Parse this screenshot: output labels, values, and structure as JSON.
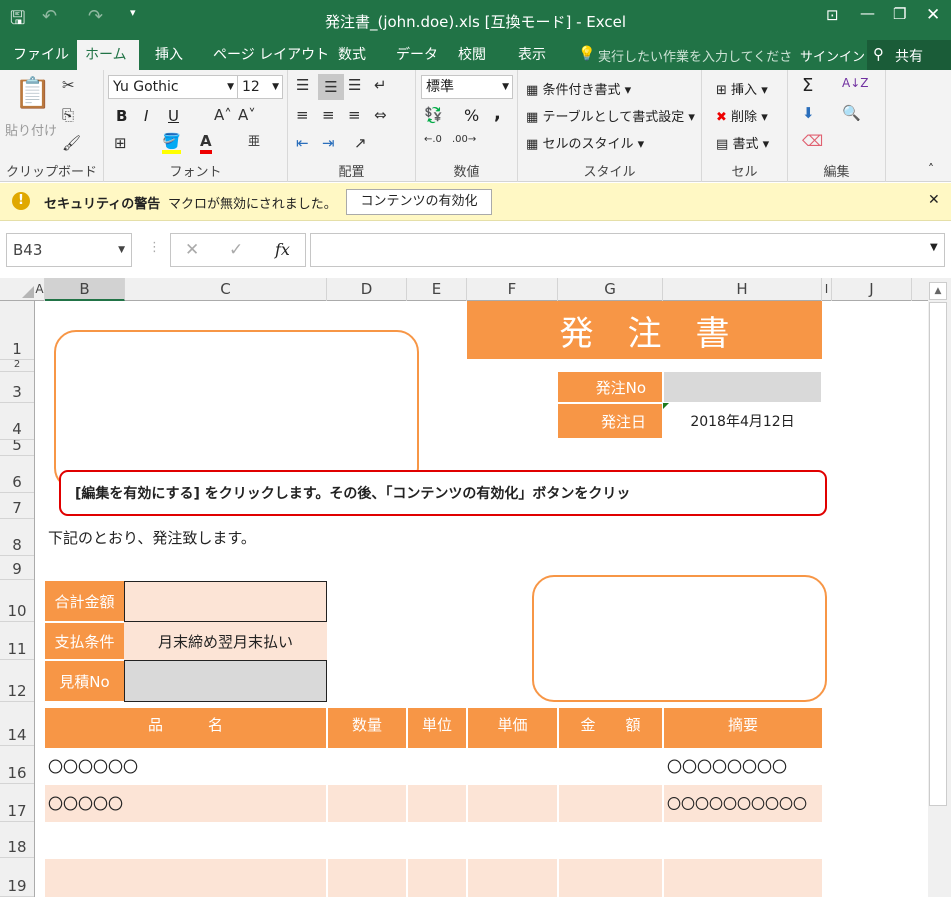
{
  "window": {
    "title": "発注書_(john.doe).xls  [互換モード] - Excel"
  },
  "tabs": [
    {
      "label": "ファイル"
    },
    {
      "label": "ホーム"
    },
    {
      "label": "挿入"
    },
    {
      "label": "ページ レイアウト"
    },
    {
      "label": "数式"
    },
    {
      "label": "データ"
    },
    {
      "label": "校閲"
    },
    {
      "label": "表示"
    }
  ],
  "tellme": {
    "placeholder": "実行したい作業を入力してくださ"
  },
  "signin": "サインイン",
  "share": "共有",
  "ribbon": {
    "clipboard": {
      "paste": "貼り付け",
      "label": "クリップボード"
    },
    "font": {
      "name": "Yu Gothic",
      "size": "12",
      "label": "フォント",
      "bold": "B",
      "italic": "I",
      "underline": "U"
    },
    "alignment": {
      "label": "配置"
    },
    "number": {
      "format": "標準",
      "label": "数値",
      "percent": "%",
      "comma": ","
    },
    "styles": {
      "conditional": "条件付き書式",
      "table": "テーブルとして書式設定",
      "cell": "セルのスタイル",
      "label": "スタイル"
    },
    "cells": {
      "insert": "挿入",
      "delete": "削除",
      "format": "書式",
      "label": "セル"
    },
    "editing": {
      "label": "編集",
      "sum": "Σ"
    }
  },
  "security": {
    "title": "セキュリティの警告",
    "message": "マクロが無効にされました。",
    "button": "コンテンツの有効化"
  },
  "formula_bar": {
    "name_box": "B43",
    "fx": "fx",
    "value": ""
  },
  "columns": [
    "A",
    "B",
    "C",
    "D",
    "E",
    "F",
    "G",
    "H",
    "I",
    "J"
  ],
  "rows": [
    "1",
    "2",
    "3",
    "4",
    "5",
    "6",
    "7",
    "8",
    "9",
    "10",
    "11",
    "12",
    "14",
    "16",
    "17",
    "18",
    "19"
  ],
  "sheet": {
    "title": "発　注　書",
    "order_no_label": "発注No",
    "order_no": "",
    "order_date_label": "発注日",
    "order_date": "2018年4月12日",
    "notice": "[編集を有効にする] をクリックします。その後、「コンテンツの有効化」ボタンをクリッ",
    "intro": "下記のとおり、発注致します。",
    "total_label": "合計金額",
    "total": "",
    "payment_label": "支払条件",
    "payment": "月末締め翌月末払い",
    "quote_label": "見積No",
    "quote": "",
    "table_headers": [
      "品　　　名",
      "数量",
      "単位",
      "単価",
      "金　　額",
      "摘要"
    ],
    "items": [
      {
        "name": "〇〇〇〇〇〇",
        "note": "〇〇〇〇〇〇〇〇"
      },
      {
        "name": "〇〇〇〇〇",
        "note": "〇〇〇〇〇〇〇〇〇〇"
      }
    ]
  },
  "colors": {
    "excel_green": "#217346",
    "accent_orange": "#f79646",
    "light_orange": "#fce4d6",
    "notice_red": "#e00000"
  }
}
